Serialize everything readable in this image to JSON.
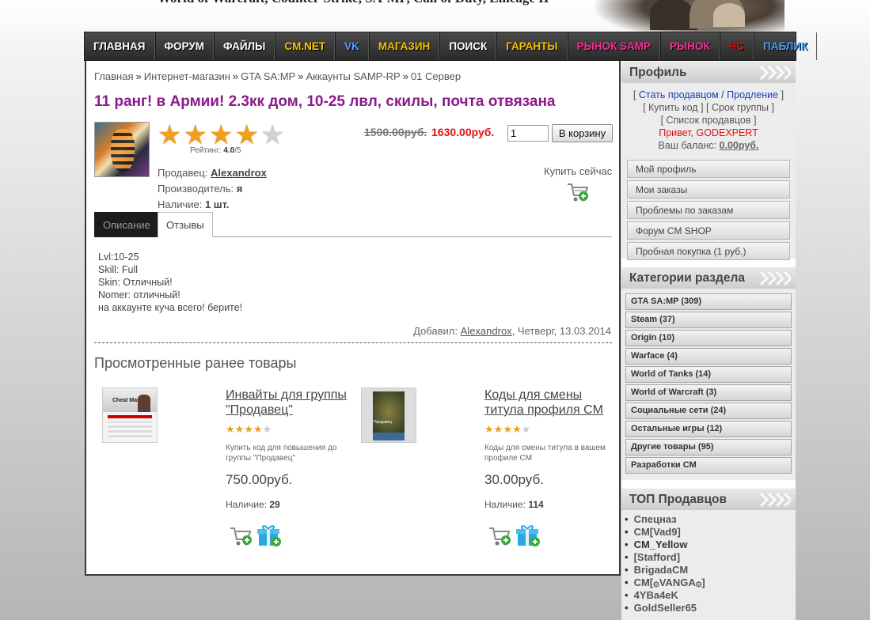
{
  "header": {
    "banner_text": "World of Warcraft, Counter-Strike, SA-MP, Call of Duty, Lineage II"
  },
  "nav": {
    "items": [
      {
        "label": "ГЛАВНАЯ",
        "color": "#ffffff"
      },
      {
        "label": "ФОРУМ",
        "color": "#ffffff"
      },
      {
        "label": "ФАЙЛЫ",
        "color": "#ffffff"
      },
      {
        "label": "CM.NET",
        "color": "#f5c400"
      },
      {
        "label": "VK",
        "color": "#4aa0ff"
      },
      {
        "label": "МАГАЗИН",
        "color": "#f5c400"
      },
      {
        "label": "ПОИСК",
        "color": "#ffffff"
      },
      {
        "label": "ГАРАНТЫ",
        "color": "#f5c400"
      },
      {
        "label": "РЫНОК SAMP",
        "color": "#ff2a9a"
      },
      {
        "label": "РЫНОК",
        "color": "#ff2a9a"
      },
      {
        "label": "ЧС",
        "color": "#e01010"
      },
      {
        "label": "Паблик",
        "color": "#4aa0ff"
      }
    ]
  },
  "breadcrumb": {
    "items": [
      "Главная",
      "Интернет-магазин",
      "GTA SA:MP",
      "Аккаунты SAMP-RP",
      "01 Сервер"
    ],
    "separator": "»"
  },
  "product": {
    "title": "11 ранг! в Армии! 2.3кк дом, 10-25 лвл, скилы, почта отвязана",
    "rating_stars": 4,
    "rating_max": 5,
    "rating_label": "Рейтинг:",
    "rating_value": "4.0",
    "rating_suffix": "/5",
    "old_price": "1500.00руб.",
    "new_price": "1630.00руб.",
    "quantity": "1",
    "cart_button": "В корзину",
    "seller_label": "Продавец:",
    "seller": "Alexandrox",
    "maker_label": "Производитель:",
    "maker": "я",
    "stock_label": "Наличие:",
    "stock": "1 шт.",
    "buy_now": "Купить сейчас"
  },
  "tabs": [
    "Описание",
    "Отзывы"
  ],
  "description": [
    "Lvl:10-25",
    "Skill: Full",
    "Skin: Отличный!",
    "Nomer: отличный!",
    "на аккаунте куча всего! берите!"
  ],
  "added": {
    "label": "Добавил:",
    "author": "Alexandrox",
    "date": ", Четверг, 13.03.2014"
  },
  "viewed": {
    "heading": "Просмотренные ранее товары",
    "items": [
      {
        "title": "Инвайты для группы \"Продавец\"",
        "rating": 4,
        "description": "Купить код для повышения до группы \"Продавец\"",
        "price": "750.00руб.",
        "stock_label": "Наличие:",
        "stock": "29",
        "thumb_caption": "Cheat Master"
      },
      {
        "title": "Коды для смены титула профиля CM",
        "rating": 4,
        "description": "Коды для смены титула в вашем профиле CM",
        "price": "30.00руб.",
        "stock_label": "Наличие:",
        "stock": "114",
        "thumb_caption": "Продавец"
      }
    ]
  },
  "sidebar": {
    "profile": {
      "heading": "Профиль",
      "link_renew": "Стать продавцом / Продление",
      "link_buy_code": "Купить код",
      "link_group_term": "Срок группы",
      "link_sellers_list": "Список продавцов",
      "greeting": "Привет, GODEXPERT",
      "balance_label": "Ваш баланс:",
      "balance_value": "0.00руб.",
      "buttons": [
        "Мой профиль",
        "Мои заказы",
        "Проблемы по заказам",
        "Форум CM SHOP",
        "Пробная покупка (1 руб.)"
      ]
    },
    "categories": {
      "heading": "Категории раздела",
      "items": [
        "GTA SA:MP (309)",
        "Steam (37)",
        "Origin (10)",
        "Warface (4)",
        "World of Tanks (14)",
        "World of Warcraft (3)",
        "Социальные сети (24)",
        "Остальные игры (12)",
        "Другие товары (95)",
        "Разработки CM"
      ]
    },
    "top_sellers": {
      "heading": "ТОП Продавцов",
      "items": [
        "Спецназ",
        "CM[Vad9]",
        "CM_Yellow",
        "[Stafford]",
        "BrigadaCM",
        "CM[۞VANGA۞]",
        "4YBa4eK",
        "GoldSeller65"
      ]
    }
  }
}
